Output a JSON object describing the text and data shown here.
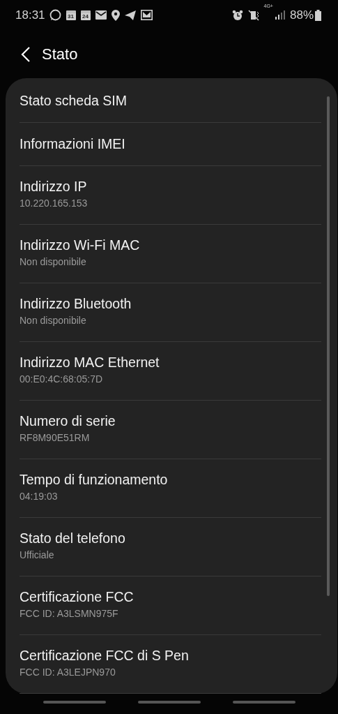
{
  "status_bar": {
    "time": "18:31",
    "calendar_days": [
      "31",
      "24"
    ],
    "network_type": "4G+",
    "battery": "88%"
  },
  "header": {
    "title": "Stato"
  },
  "items": [
    {
      "title": "Stato scheda SIM"
    },
    {
      "title": "Informazioni IMEI"
    },
    {
      "title": "Indirizzo IP",
      "value": "10.220.165.153"
    },
    {
      "title": "Indirizzo Wi‑Fi MAC",
      "value": "Non disponibile"
    },
    {
      "title": "Indirizzo Bluetooth",
      "value": "Non disponibile"
    },
    {
      "title": "Indirizzo MAC Ethernet",
      "value": "00:E0:4C:68:05:7D"
    },
    {
      "title": "Numero di serie",
      "value": "RF8M90E51RM"
    },
    {
      "title": "Tempo di funzionamento",
      "value": "04:19:03"
    },
    {
      "title": "Stato del telefono",
      "value": "Ufficiale"
    },
    {
      "title": "Certificazione FCC",
      "value": "FCC ID: A3LSMN975F"
    },
    {
      "title": "Certificazione FCC di S Pen",
      "value": "FCC ID: A3LEJPN970"
    }
  ]
}
